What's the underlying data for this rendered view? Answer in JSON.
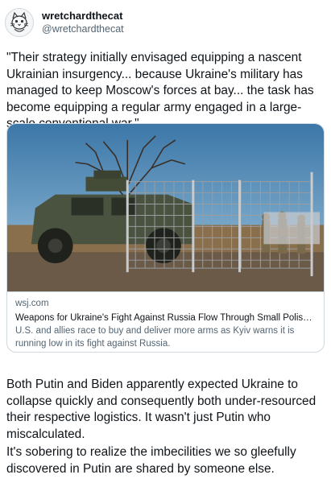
{
  "tweet": {
    "display_name": "wretchardthecat",
    "handle": "@wretchardthecat",
    "avatar_icon": "cat-sketch-avatar-icon",
    "text": "\"Their strategy initially envisaged equipping a nascent Ukrainian insurgency... because Ukraine's military has managed to keep Moscow's forces at bay... the task has become equipping a regular army engaged in a large-scale conventional war.\""
  },
  "card": {
    "image_icon": "armored-humvee-at-border-fence-photo",
    "domain": "wsj.com",
    "title": "Weapons for Ukraine's Fight Against Russia Flow Through Small Polish Border T...",
    "description": "U.S. and allies race to buy and deliver more arms as Kyiv warns it is running low in its fight against Russia."
  },
  "replies": [
    {
      "text": "Both Putin and Biden apparently expected Ukraine to collapse quickly and consequently both under-resourced their respective logistics. It wasn't just Putin who miscalculated."
    },
    {
      "text": "It's sobering to realize the imbecilities we so gleefully discovered in Putin are shared by someone else."
    }
  ],
  "colors": {
    "text": "#0f1419",
    "secondary": "#536471",
    "border": "#cfd9de"
  }
}
